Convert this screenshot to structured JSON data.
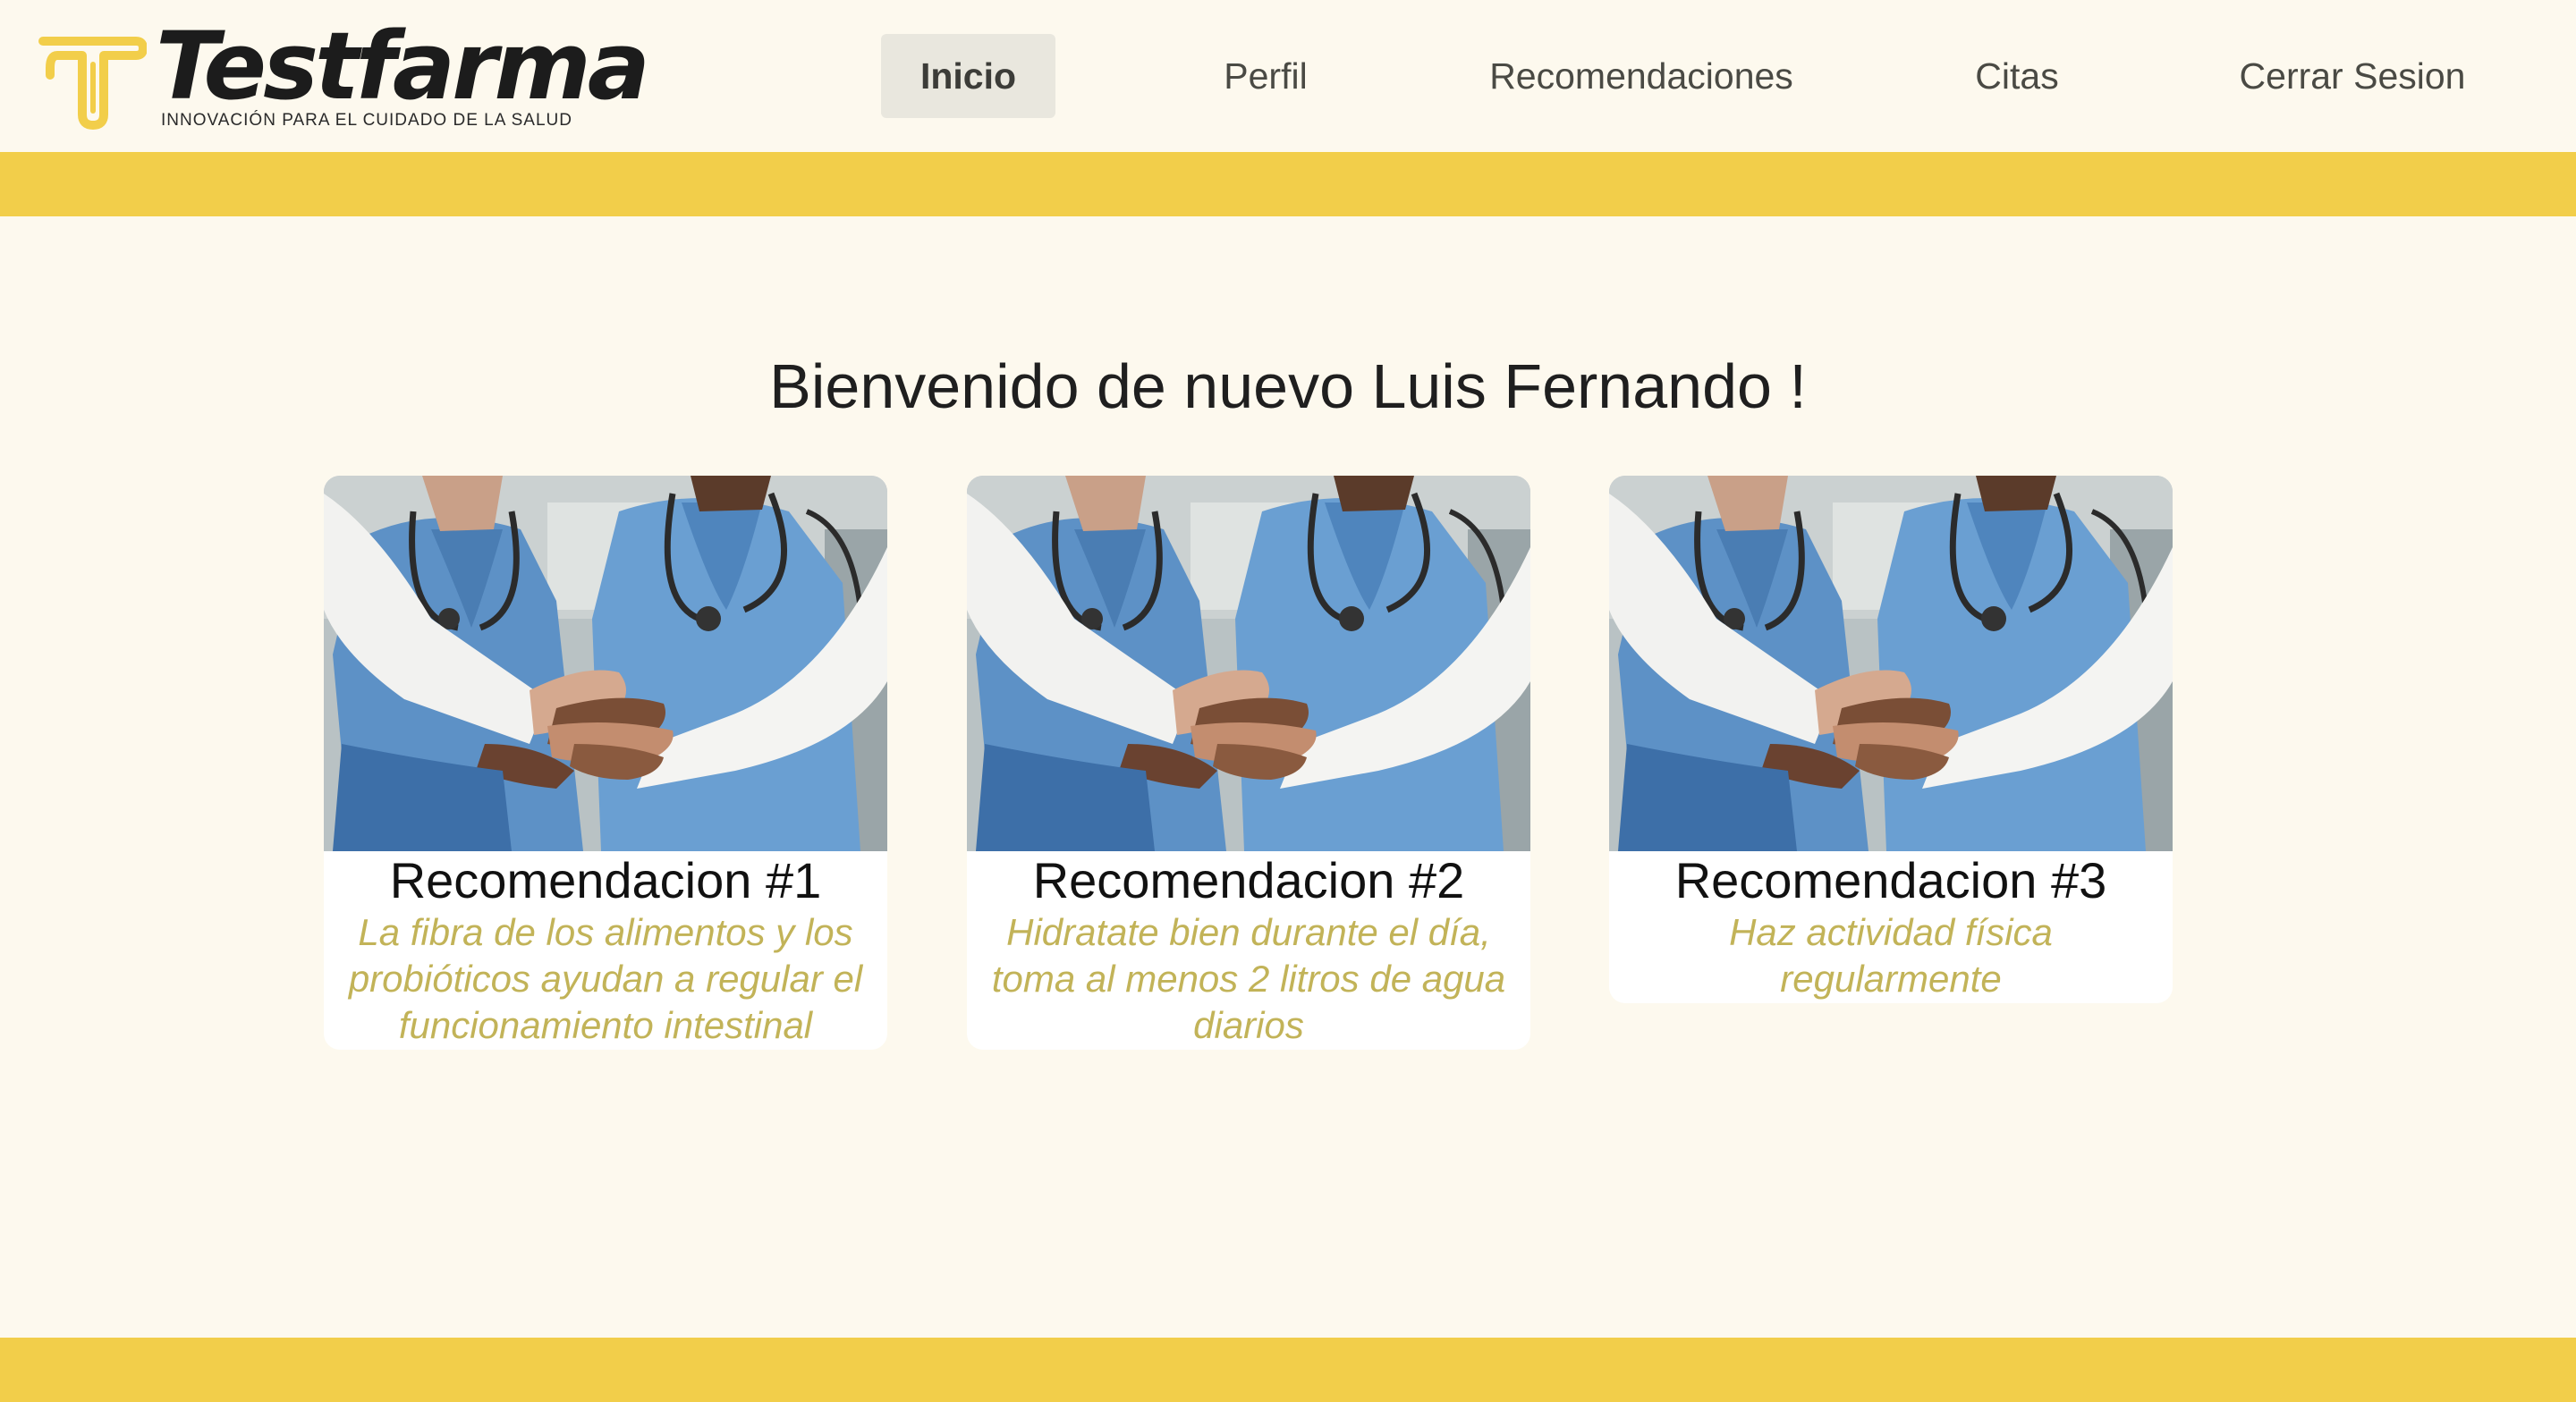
{
  "brand": {
    "name": "Testfarma",
    "tagline": "INNOVACIÓN PARA EL CUIDADO DE LA SALUD",
    "logo_icon": "t-logo-icon"
  },
  "nav": {
    "items": [
      {
        "label": "Inicio",
        "active": true
      },
      {
        "label": "Perfil",
        "active": false
      },
      {
        "label": "Recomendaciones",
        "active": false
      },
      {
        "label": "Citas",
        "active": false
      },
      {
        "label": "Cerrar Sesion",
        "active": false
      }
    ]
  },
  "welcome": "Bienvenido de nuevo Luis Fernando !",
  "cards": [
    {
      "title": "Recomendacion #1",
      "text": "La fibra de los alimentos y los probióticos ayudan a regular el funcionamiento intestinal"
    },
    {
      "title": "Recomendacion #2",
      "text": "Hidratate bien durante el día, toma al menos 2 litros de agua diarios"
    },
    {
      "title": "Recomendacion #3",
      "text": "Haz actividad física regularmente"
    }
  ],
  "colors": {
    "background": "#fdf9ee",
    "accent": "#f2ce4a",
    "card_text": "#c2b358",
    "nav_active_bg": "#e9e7de"
  }
}
